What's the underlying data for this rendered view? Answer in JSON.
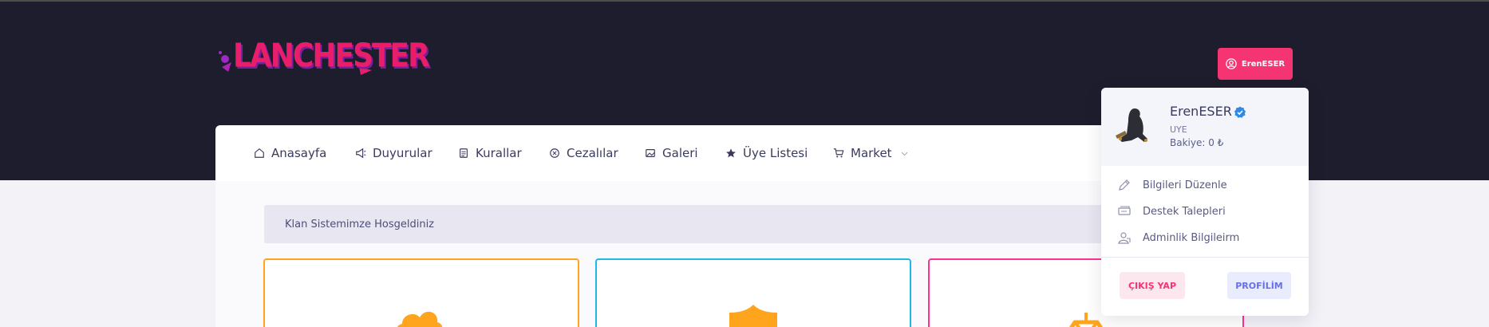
{
  "brand": {
    "logo_text": "LANCHESTER"
  },
  "user_button": {
    "label": "ErenESER",
    "icon": "user-circle-icon"
  },
  "nav": {
    "items": [
      {
        "label": "Anasayfa",
        "icon": "home-icon"
      },
      {
        "label": "Duyurular",
        "icon": "megaphone-icon"
      },
      {
        "label": "Kurallar",
        "icon": "document-icon"
      },
      {
        "label": "Cezalılar",
        "icon": "x-circle-icon"
      },
      {
        "label": "Galeri",
        "icon": "image-icon"
      },
      {
        "label": "Üye Listesi",
        "icon": "star-icon"
      },
      {
        "label": "Market",
        "icon": "cart-icon"
      }
    ]
  },
  "content": {
    "welcome": "Klan Sistemimze Hosgeldiniz",
    "cards": [
      {
        "accent": "#ffa51d",
        "icon": "cloud-check-icon"
      },
      {
        "accent": "#1cbbe8",
        "icon": "shield-icon"
      },
      {
        "accent": "#ff2f94",
        "icon": "gem-icon"
      }
    ]
  },
  "dropdown": {
    "name": "ErenESER",
    "role": "UYE",
    "balance": "Bakiye: 0 ₺",
    "items": [
      {
        "label": "Bilgileri Düzenle",
        "icon": "pencil-icon"
      },
      {
        "label": "Destek Talepleri",
        "icon": "ticket-icon"
      },
      {
        "label": "Adminlik Bilgileirm",
        "icon": "user-badge-icon"
      }
    ],
    "logout_label": "ÇIKIŞ YAP",
    "profile_label": "PROFİLİM"
  },
  "colors": {
    "header_bg": "#1d1d2d",
    "accent_pink": "#f53573",
    "nav_text": "#3a3b5c",
    "page_bg": "#f3f2f7"
  }
}
